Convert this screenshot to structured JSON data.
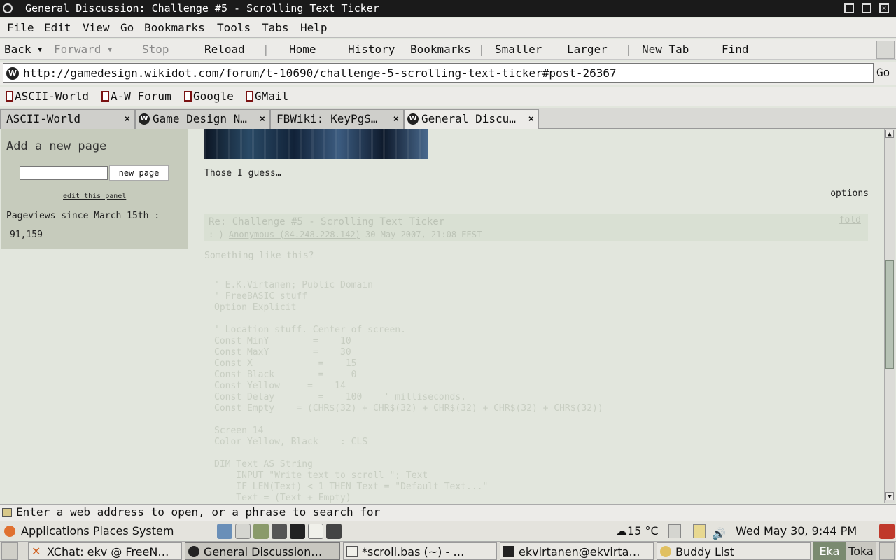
{
  "window": {
    "title": "General Discussion: Challenge #5 - Scrolling Text Ticker"
  },
  "menu": [
    "File",
    "Edit",
    "View",
    "Go",
    "Bookmarks",
    "Tools",
    "Tabs",
    "Help"
  ],
  "nav": {
    "back": "Back",
    "forward": "Forward",
    "stop": "Stop",
    "reload": "Reload",
    "home": "Home",
    "history": "History",
    "bookmarks": "Bookmarks",
    "smaller": "Smaller",
    "larger": "Larger",
    "new_tab": "New Tab",
    "find": "Find"
  },
  "address": {
    "url": "http://gamedesign.wikidot.com/forum/t-10690/challenge-5-scrolling-text-ticker#post-26367",
    "go": "Go"
  },
  "bookmarks": [
    "ASCII-World",
    "A-W Forum",
    "Google",
    "GMail"
  ],
  "tabs": [
    {
      "label": "ASCII-World"
    },
    {
      "label": "Game Design N…"
    },
    {
      "label": "FBWiki: KeyPgS…"
    },
    {
      "label": "General Discu…"
    }
  ],
  "sidebar": {
    "heading": "Add a new page",
    "button": "new page",
    "edit_link": "edit this panel",
    "pageviews_label": "Pageviews since March 15th :",
    "pageviews_value": "91,159"
  },
  "post": {
    "body": "Those I guess…",
    "options": "options"
  },
  "reply": {
    "title": "Re: Challenge #5 - Scrolling Text Ticker",
    "fold": "fold",
    "author": "Anonymous (84.248.228.142)",
    "date": "30 May 2007, 21:08 EEST",
    "intro": "Something like this?"
  },
  "code": [
    "' E.K.Virtanen; Public Domain",
    "' FreeBASIC stuff",
    "Option Explicit",
    "",
    "' Location stuff. Center of screen.",
    "Const MinY        =    10",
    "Const MaxY        =    30",
    "Const X            =    15",
    "Const Black        =     0",
    "Const Yellow     =    14",
    "Const Delay        =    100    ' milliseconds.",
    "Const Empty    = (CHR$(32) + CHR$(32) + CHR$(32) + CHR$(32) + CHR$(32))",
    "",
    "Screen 14",
    "Color Yellow, Black    : CLS",
    "",
    "DIM Text AS String",
    "    INPUT \"Write text to scroll \"; Text",
    "    IF LEN(Text) < 1 THEN Text = \"Default Text...\"",
    "    Text = (Text + Empty)"
  ],
  "status": {
    "text": "Enter a web address to open, or a phrase to search for"
  },
  "panel": {
    "applications": "Applications",
    "places": "Places",
    "system": "System",
    "weather": "15 °C",
    "clock": "Wed May 30,   9:44 PM"
  },
  "taskbar": [
    {
      "label": "XChat: ekv @ FreeN…"
    },
    {
      "label": "General Discussion…"
    },
    {
      "label": "*scroll.bas (~) - …"
    },
    {
      "label": "ekvirtanen@ekvirta…"
    },
    {
      "label": "Buddy List"
    }
  ],
  "workspaces": [
    "Eka",
    "Toka"
  ]
}
